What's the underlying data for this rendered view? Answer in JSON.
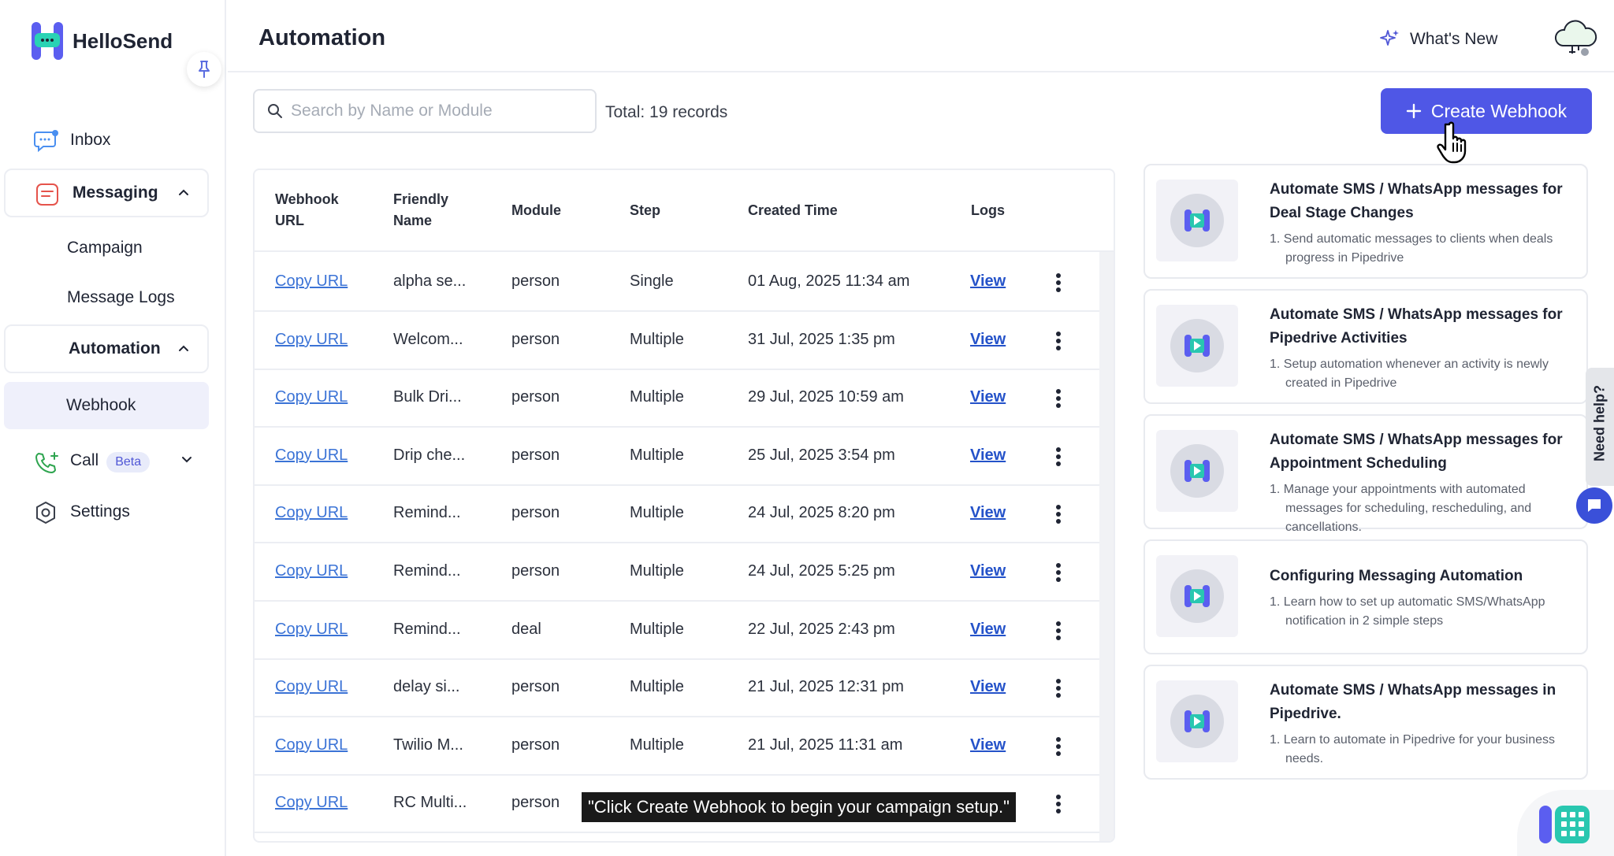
{
  "brand": {
    "name": "HelloSend"
  },
  "sidebar": {
    "items": [
      {
        "label": "Inbox"
      },
      {
        "label": "Messaging"
      },
      {
        "label": "Campaign"
      },
      {
        "label": "Message Logs"
      },
      {
        "label": "Automation"
      },
      {
        "label": "Webhook"
      },
      {
        "label": "Call",
        "badge": "Beta"
      },
      {
        "label": "Settings"
      }
    ]
  },
  "header": {
    "title": "Automation",
    "whats_new": "What's New"
  },
  "toolbar": {
    "search_placeholder": "Search by Name or Module",
    "total": "Total: 19 records",
    "create_label": "Create Webhook"
  },
  "table": {
    "headers": [
      "Webhook URL",
      "Friendly Name",
      "Module",
      "Step",
      "Created Time",
      "Logs"
    ],
    "header_lines": {
      "webhook_url": [
        "Webhook",
        "URL"
      ],
      "friendly_name": [
        "Friendly",
        "Name"
      ]
    },
    "rows": [
      {
        "url": "Copy URL",
        "name": "alpha se...",
        "module": "person",
        "step": "Single",
        "created": "01 Aug, 2025 11:34 am",
        "logs": "View"
      },
      {
        "url": "Copy URL",
        "name": "Welcom...",
        "module": "person",
        "step": "Multiple",
        "created": "31 Jul, 2025 1:35 pm",
        "logs": "View"
      },
      {
        "url": "Copy URL",
        "name": "Bulk Dri...",
        "module": "person",
        "step": "Multiple",
        "created": "29 Jul, 2025 10:59 am",
        "logs": "View"
      },
      {
        "url": "Copy URL",
        "name": "Drip che...",
        "module": "person",
        "step": "Multiple",
        "created": "25 Jul, 2025 3:54 pm",
        "logs": "View"
      },
      {
        "url": "Copy URL",
        "name": "Remind...",
        "module": "person",
        "step": "Multiple",
        "created": "24 Jul, 2025 8:20 pm",
        "logs": "View"
      },
      {
        "url": "Copy URL",
        "name": "Remind...",
        "module": "person",
        "step": "Multiple",
        "created": "24 Jul, 2025 5:25 pm",
        "logs": "View"
      },
      {
        "url": "Copy URL",
        "name": "Remind...",
        "module": "deal",
        "step": "Multiple",
        "created": "22 Jul, 2025 2:43 pm",
        "logs": "View"
      },
      {
        "url": "Copy URL",
        "name": "delay si...",
        "module": "person",
        "step": "Multiple",
        "created": "21 Jul, 2025 12:31 pm",
        "logs": "View"
      },
      {
        "url": "Copy URL",
        "name": "Twilio M...",
        "module": "person",
        "step": "Multiple",
        "created": "21 Jul, 2025 11:31 am",
        "logs": "View"
      },
      {
        "url": "Copy URL",
        "name": "RC Multi...",
        "module": "person",
        "step": "",
        "created": "",
        "logs": ""
      }
    ]
  },
  "cards": [
    {
      "title": "Automate SMS / WhatsApp messages for Deal Stage Changes",
      "desc": "1. Send automatic messages to clients when deals progress in Pipedrive"
    },
    {
      "title": "Automate SMS / WhatsApp messages for Pipedrive Activities",
      "desc": "1. Setup automation whenever an activity is newly created in Pipedrive"
    },
    {
      "title": "Automate SMS / WhatsApp messages for Appointment Scheduling",
      "desc": "1. Manage your appointments with automated messages for scheduling, rescheduling, and cancellations."
    },
    {
      "title": "Configuring Messaging Automation",
      "desc": "1. Learn how to set up automatic SMS/WhatsApp notification in 2 simple steps"
    },
    {
      "title": "Automate SMS / WhatsApp messages in Pipedrive.",
      "desc": "1. Learn to automate in Pipedrive for your business needs."
    }
  ],
  "help": {
    "label": "Need help?"
  },
  "caption": "\"Click Create Webhook to begin your campaign setup.\"",
  "colors": {
    "accent": "#4f57e6",
    "link": "#3b73d6",
    "active_bg": "#eff0fb"
  }
}
